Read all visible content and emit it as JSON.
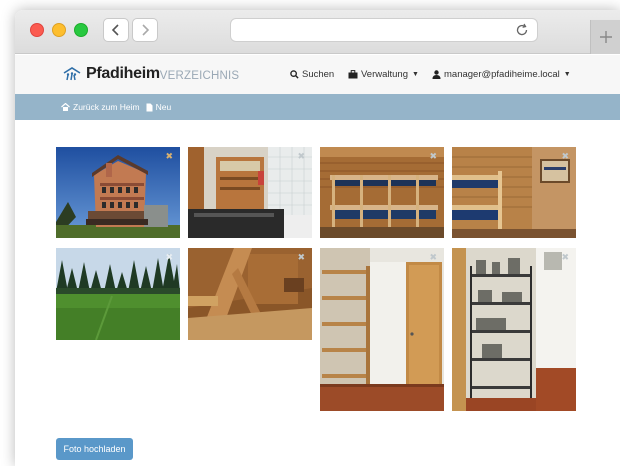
{
  "app": {
    "brand_main": "Pfadiheim",
    "brand_sub": "VERZEICHNIS"
  },
  "nav": {
    "search_label": "Suchen",
    "admin_label": "Verwaltung",
    "user_label": "manager@pfadiheime.local"
  },
  "breadcrumb": {
    "back_label": "Zurück zum Heim",
    "new_label": "Neu"
  },
  "actions": {
    "upload_label": "Foto hochladen",
    "delete_glyph": "✖"
  },
  "photos": [
    {
      "subject": "building-exterior"
    },
    {
      "subject": "kitchen"
    },
    {
      "subject": "bunk-beds"
    },
    {
      "subject": "bunk-beds-corner"
    },
    {
      "subject": "meadow"
    },
    {
      "subject": "attic"
    },
    {
      "subject": "hallway-shelves"
    },
    {
      "subject": "storage-racks"
    }
  ],
  "colors": {
    "crumb_bar": "#95b4c9",
    "upload_button": "#5a98c9",
    "brand_sub": "#9aa8b5"
  },
  "icons": [
    "back-arrow-icon",
    "forward-arrow-icon",
    "reload-icon",
    "plus-icon",
    "logo-icon",
    "search-icon",
    "briefcase-icon",
    "user-icon",
    "home-icon",
    "file-icon",
    "close-icon"
  ]
}
